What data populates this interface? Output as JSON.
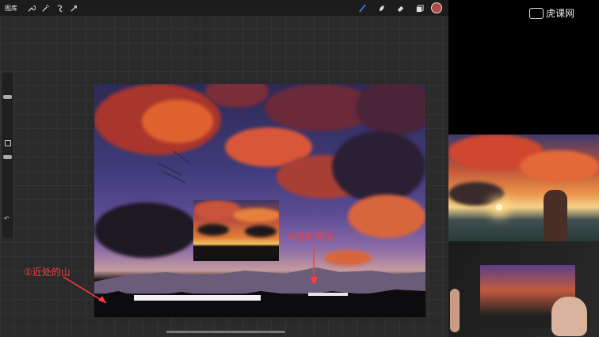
{
  "toolbar": {
    "gallery_label": "图库",
    "left_tools": [
      "wrench-icon",
      "magic-wand-icon",
      "selection-icon",
      "transform-icon"
    ],
    "right_tools": [
      "brush-icon",
      "smudge-icon",
      "eraser-icon",
      "layers-icon"
    ],
    "accent_color": "#3b82f6",
    "current_color": "#b24a4a"
  },
  "annotations": {
    "near_mountain": "①近处的山",
    "far_mountain": "②远处的山",
    "color": "#ff3b3b"
  },
  "watermark": {
    "text": "虎课网"
  }
}
